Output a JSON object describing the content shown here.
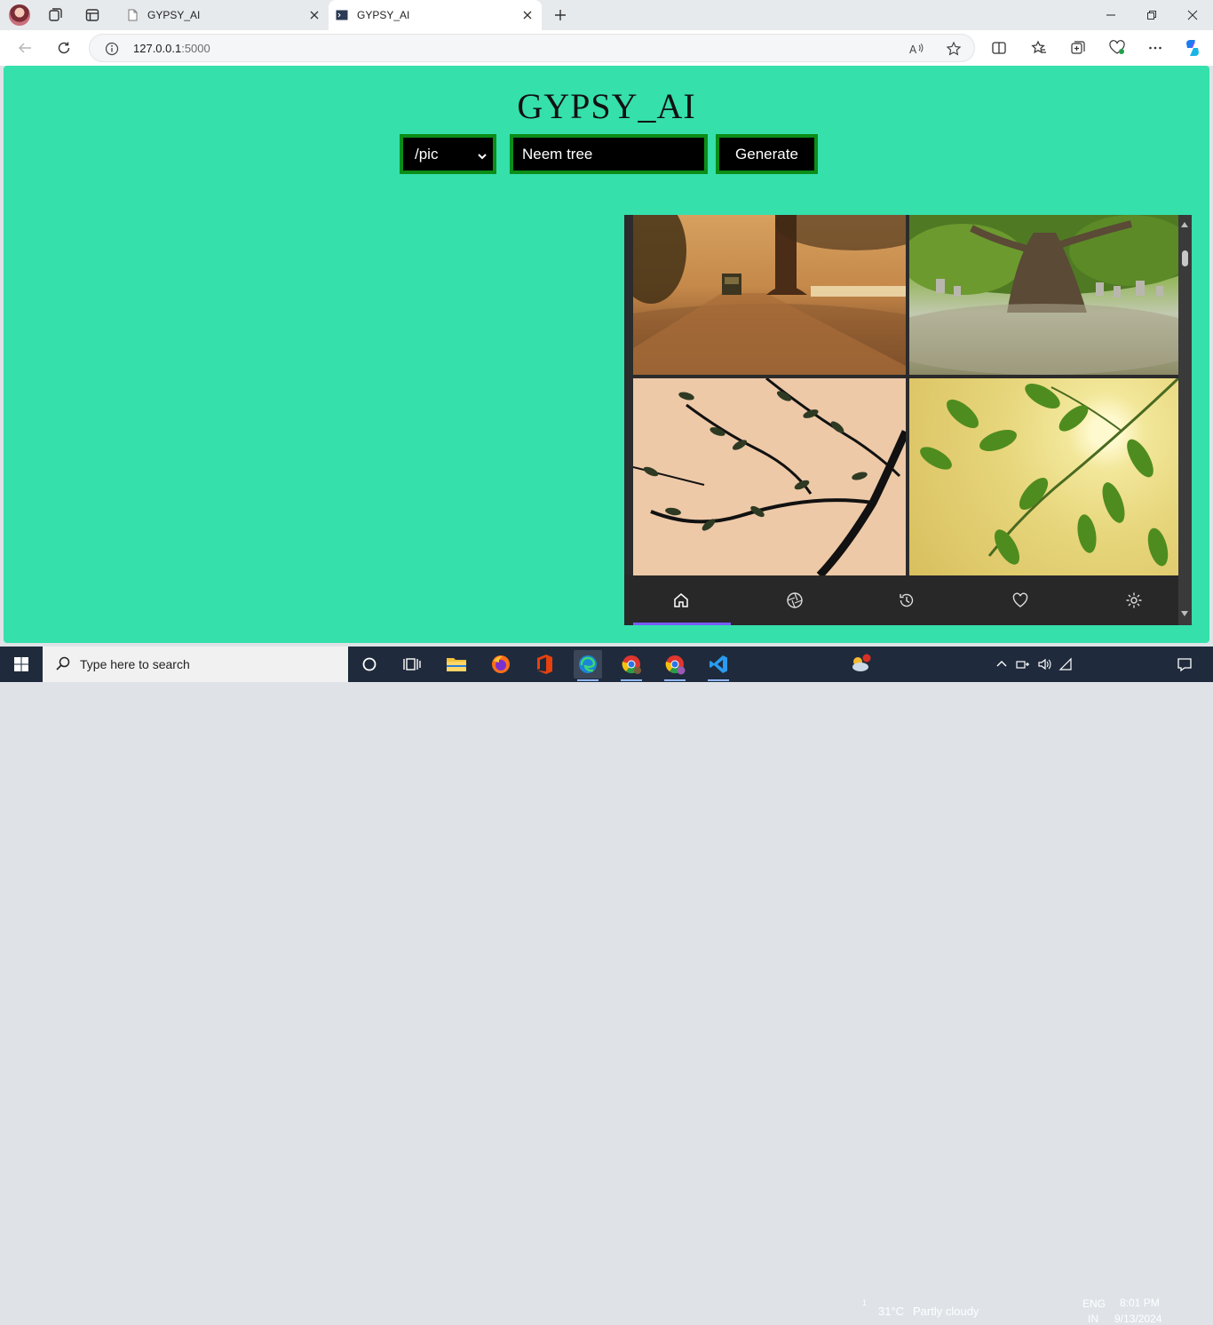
{
  "browser": {
    "tabs": [
      {
        "title": "GYPSY_AI",
        "active": false
      },
      {
        "title": "GYPSY_AI",
        "active": true
      }
    ],
    "address": {
      "host": "127.0.0.1",
      "port": ":5000"
    }
  },
  "page": {
    "title": "GYPSY_AI",
    "mode_select": {
      "value": "/pic"
    },
    "prompt_input": {
      "value": "Neem tree"
    },
    "generate_button": "Generate",
    "accent_color": "#35e0ab",
    "control_border_color": "#0b8d18"
  },
  "gallery": {
    "images": [
      "dusty-road-tree-image",
      "graveyard-tree-image",
      "branch-silhouette-image",
      "sunlit-leaves-image"
    ],
    "nav_items": [
      "home-icon",
      "aperture-icon",
      "history-icon",
      "heart-icon",
      "settings-icon"
    ],
    "active_nav": "home-icon"
  },
  "taskbar": {
    "search_placeholder": "Type here to search",
    "weather": {
      "temp": "31°C",
      "condition": "Partly cloudy"
    },
    "language": {
      "lang": "ENG",
      "region": "IN"
    },
    "clock": {
      "time": "8:01 PM",
      "date": "9/13/2024"
    },
    "notification_badge": "1"
  }
}
